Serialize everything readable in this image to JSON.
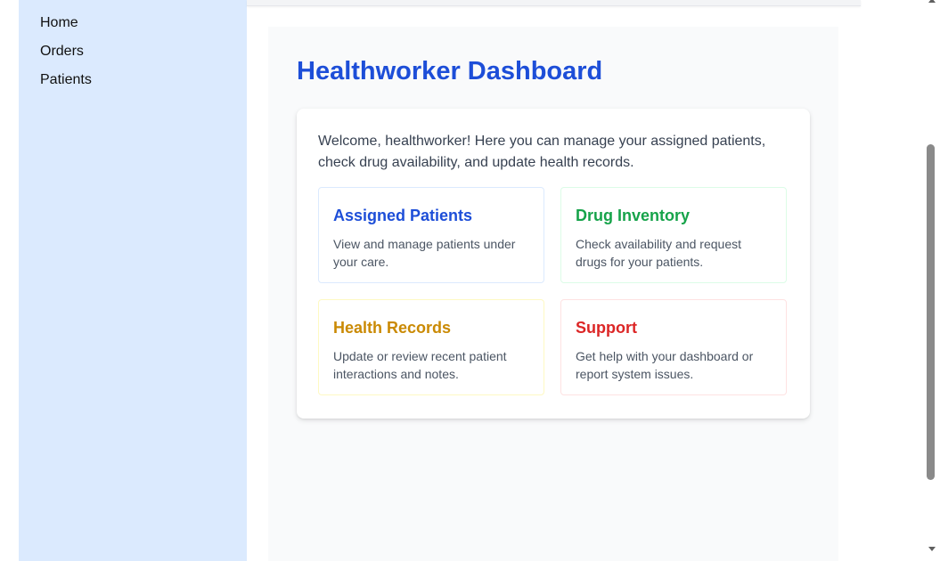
{
  "sidebar": {
    "items": [
      {
        "label": "Home"
      },
      {
        "label": "Orders"
      },
      {
        "label": "Patients"
      }
    ]
  },
  "main": {
    "title": "Healthworker Dashboard",
    "welcome": "Welcome, healthworker! Here you can manage your assigned patients, check drug availability, and update health records.",
    "cards": [
      {
        "title": "Assigned Patients",
        "description": "View and manage patients under your care.",
        "color": "#1d4ed8"
      },
      {
        "title": "Drug Inventory",
        "description": "Check availability and request drugs for your patients.",
        "color": "#16a34a"
      },
      {
        "title": "Health Records",
        "description": "Update or review recent patient interactions and notes.",
        "color": "#ca8a04"
      },
      {
        "title": "Support",
        "description": "Get help with your dashboard or report system issues.",
        "color": "#dc2626"
      }
    ]
  },
  "colors": {
    "sidebar_bg": "#dbeafe",
    "accent": "#1d4ed8"
  }
}
